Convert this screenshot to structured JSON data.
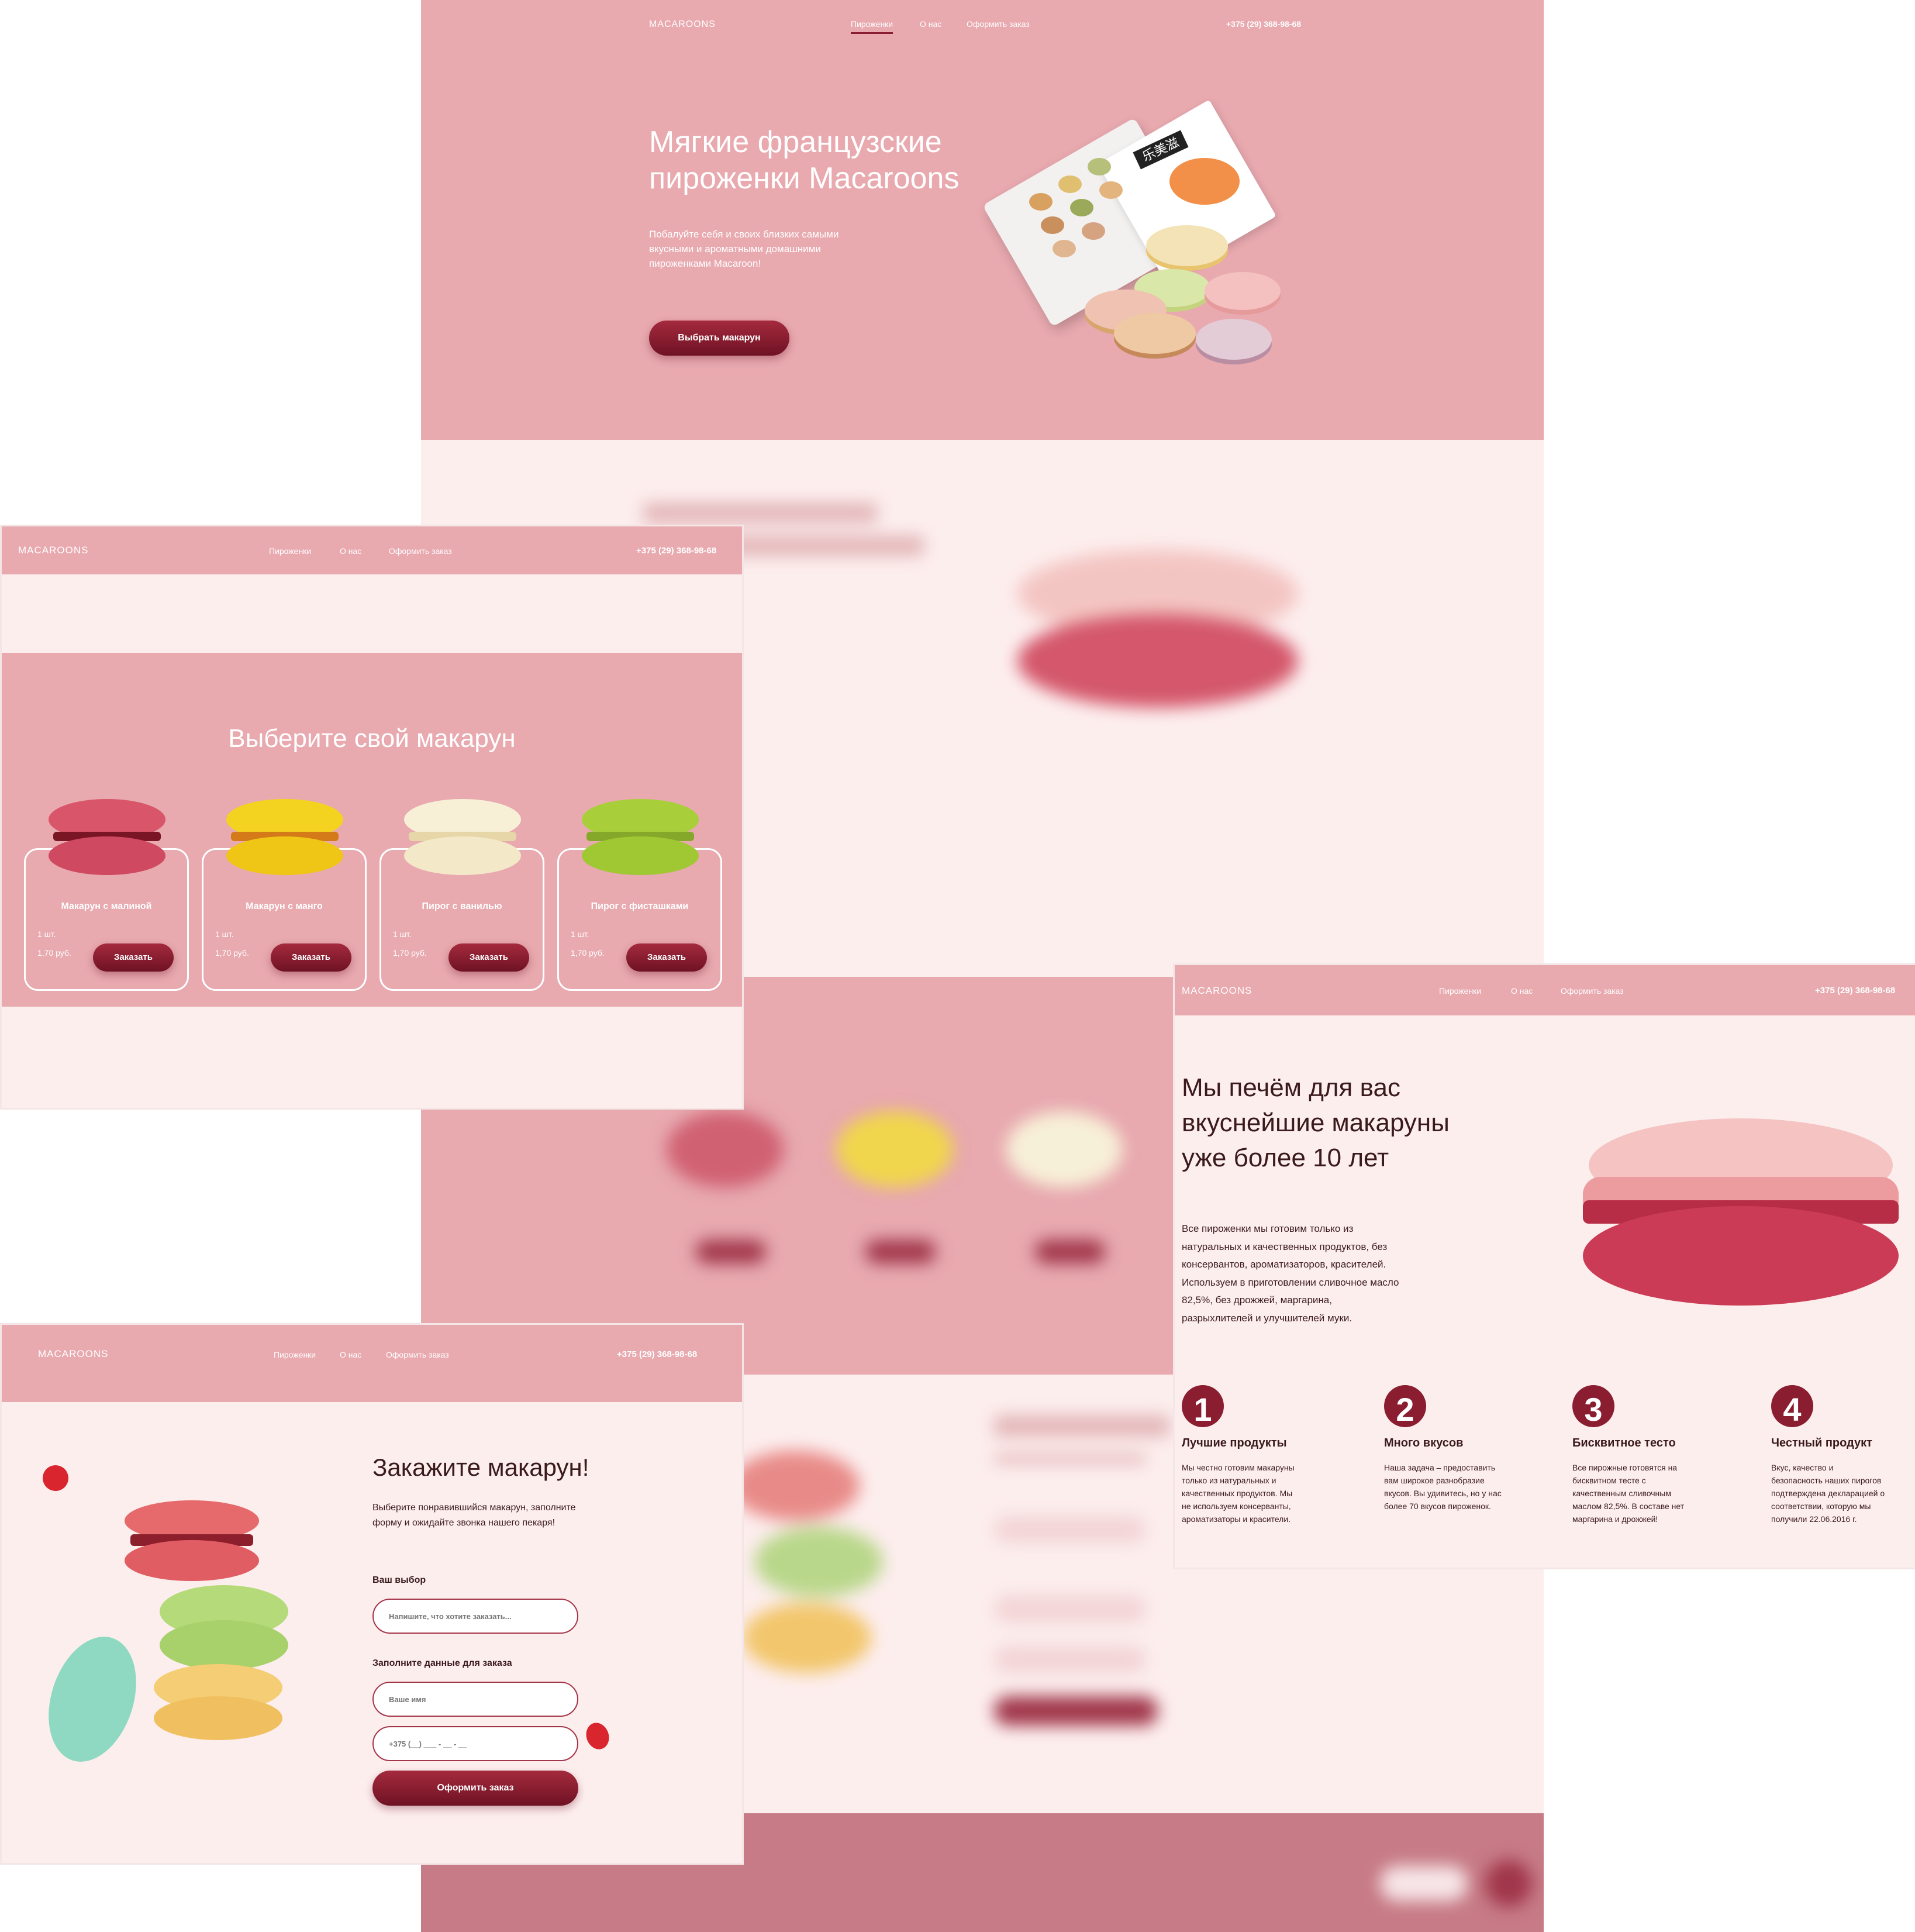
{
  "site": {
    "logo": "MACAROONS",
    "nav": [
      "Пироженки",
      "О нас",
      "Оформить заказ"
    ],
    "phone": "+375 (29) 368-98-68"
  },
  "hero": {
    "title_line1": "Мягкие французские",
    "title_line2": "пироженки Macaroons",
    "sub_line1": "Побалуйте себя и своих близких самыми",
    "sub_line2": "вкусными и ароматными домашними",
    "sub_line3": "пироженками Macaroon!",
    "button": "Выбрать макарун",
    "box_label": "乐美滋"
  },
  "catalog": {
    "title": "Выберите свой макарун",
    "items": [
      {
        "name": "Макарун с малиной",
        "qty": "1 шт.",
        "price": "1,70 руб.",
        "button": "Заказать"
      },
      {
        "name": "Макарун с манго",
        "qty": "1 шт.",
        "price": "1,70 руб.",
        "button": "Заказать"
      },
      {
        "name": "Пирог с ванилью",
        "qty": "1 шт.",
        "price": "1,70 руб.",
        "button": "Заказать"
      },
      {
        "name": "Пирог с фисташками",
        "qty": "1 шт.",
        "price": "1,70 руб.",
        "button": "Заказать"
      }
    ]
  },
  "about": {
    "title_line1": "Мы печём для вас",
    "title_line2": "вкуснейшие макаруны",
    "title_line3": "уже более 10 лет",
    "text_line1": "Все пироженки мы готовим только из",
    "text_line2": "натуральных и качественных продуктов, без",
    "text_line3": "консервантов, ароматизаторов, красителей.",
    "text_line4": "Используем в приготовлении сливочное масло",
    "text_line5": "82,5%, без дрожжей, маргарина,",
    "text_line6": "разрыхлителей и улучшителей муки.",
    "features": [
      {
        "num": "1",
        "title": "Лучшие продукты",
        "lines": [
          "Мы честно готовим макаруны",
          "только из натуральных и",
          "качественных продуктов. Мы",
          "не используем консерванты,",
          "ароматизаторы и красители."
        ]
      },
      {
        "num": "2",
        "title": "Много вкусов",
        "lines": [
          "Наша задача – предоставить",
          "вам широкое разнобразие",
          "вкусов. Вы удивитесь, но у нас",
          "более 70 вкусов пироженок."
        ]
      },
      {
        "num": "3",
        "title": "Бисквитное тесто",
        "lines": [
          "Все пирожные готовятся на",
          "бисквитном тесте с",
          "качественным сливочным",
          "маслом 82,5%. В составе нет",
          "маргарина и дрожжей!"
        ]
      },
      {
        "num": "4",
        "title": "Честный продукт",
        "lines": [
          "Вкус, качество и",
          "безопасность наших пирогов",
          "подтверждена декларацией о",
          "соответствии, которую мы",
          "получили 22.06.2016 г."
        ]
      }
    ]
  },
  "order": {
    "title": "Закажите макарун!",
    "text_line1": "Выберите понравившийся макарун, заполните",
    "text_line2": "форму и ожидайте звонка нашего пекаря!",
    "choice_label": "Ваш выбор",
    "choice_placeholder": "Напишите, что хотите заказать...",
    "data_label": "Заполните данные для заказа",
    "name_placeholder": "Ваше имя",
    "phone_placeholder": "+375 (__) ___ - __ - __",
    "button": "Оформить заказ"
  },
  "colors": {
    "pink": "#e8a9af",
    "light_pink": "#fdeeee",
    "burgundy": "#8a1d2f",
    "footer": "#c77b86"
  }
}
